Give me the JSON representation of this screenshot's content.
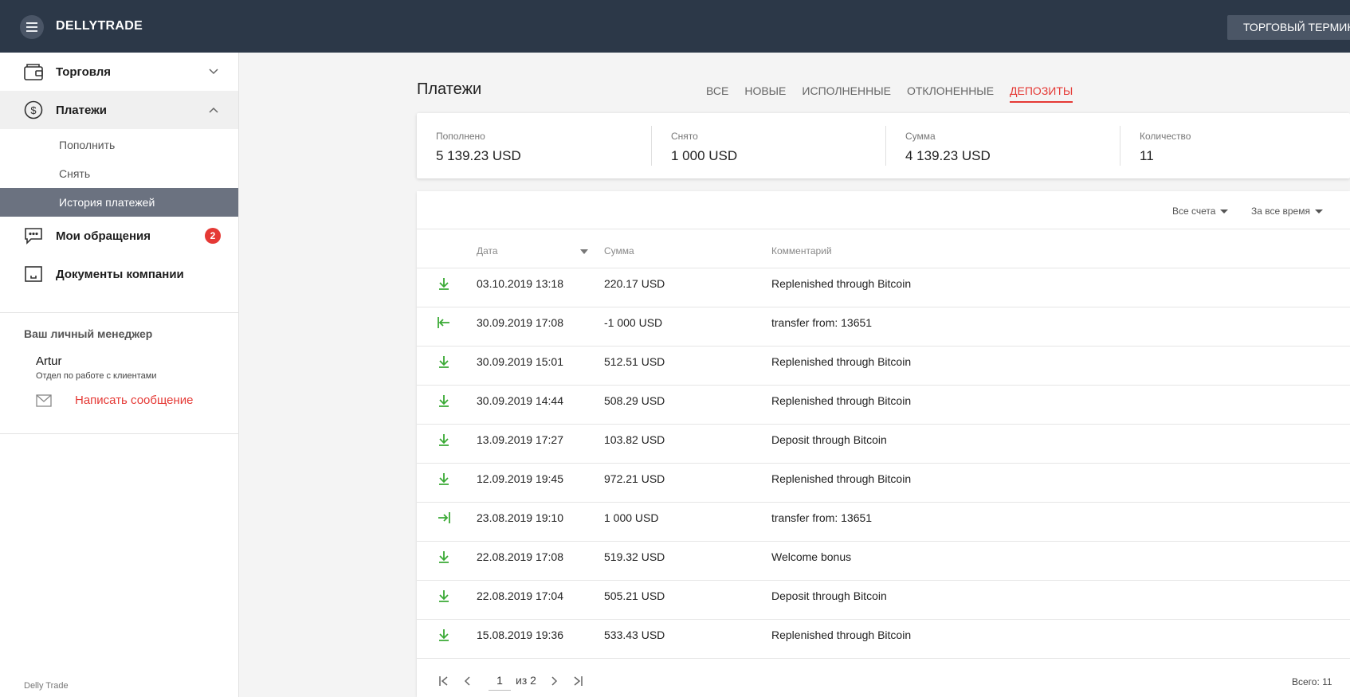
{
  "header": {
    "logo": "DELLYTRADE",
    "terminal_button": "ТОРГОВЫЙ ТЕРМИН"
  },
  "sidebar": {
    "trading": "Торговля",
    "payments": "Платежи",
    "sub": {
      "deposit": "Пополнить",
      "withdraw": "Снять",
      "history": "История платежей"
    },
    "requests": "Мои обращения",
    "requests_badge": "2",
    "documents": "Документы компании",
    "manager": {
      "title": "Ваш личный менеджер",
      "name": "Artur",
      "dept": "Отдел по работе с клиентами",
      "write": "Написать сообщение"
    },
    "footer": "Delly Trade"
  },
  "main": {
    "title": "Платежи",
    "tabs": [
      "ВСЕ",
      "НОВЫЕ",
      "ИСПОЛНЕННЫЕ",
      "ОТКЛОНЕННЫЕ",
      "ДЕПОЗИТЫ"
    ],
    "active_tab": "ДЕПОЗИТЫ",
    "summary": [
      {
        "label": "Пополнено",
        "value": "5 139.23 USD"
      },
      {
        "label": "Снято",
        "value": "1 000 USD"
      },
      {
        "label": "Сумма",
        "value": "4 139.23 USD"
      },
      {
        "label": "Количество",
        "value": "11"
      }
    ],
    "filters": {
      "accounts": "Все счета",
      "period": "За все время"
    },
    "columns": {
      "date": "Дата",
      "amount": "Сумма",
      "comment": "Комментарий"
    },
    "rows": [
      {
        "icon": "download-icon",
        "date": "03.10.2019 13:18",
        "amount": "220.17 USD",
        "comment": "Replenished through Bitcoin"
      },
      {
        "icon": "transfer-out-icon",
        "date": "30.09.2019 17:08",
        "amount": "-1 000 USD",
        "comment": "transfer from: 13651"
      },
      {
        "icon": "download-icon",
        "date": "30.09.2019 15:01",
        "amount": "512.51 USD",
        "comment": "Replenished through Bitcoin"
      },
      {
        "icon": "download-icon",
        "date": "30.09.2019 14:44",
        "amount": "508.29 USD",
        "comment": "Replenished through Bitcoin"
      },
      {
        "icon": "download-icon",
        "date": "13.09.2019 17:27",
        "amount": "103.82 USD",
        "comment": "Deposit through Bitcoin"
      },
      {
        "icon": "download-icon",
        "date": "12.09.2019 19:45",
        "amount": "972.21 USD",
        "comment": "Replenished through Bitcoin"
      },
      {
        "icon": "transfer-in-icon",
        "date": "23.08.2019 19:10",
        "amount": "1 000 USD",
        "comment": "transfer from: 13651"
      },
      {
        "icon": "download-icon",
        "date": "22.08.2019 17:08",
        "amount": "519.32 USD",
        "comment": "Welcome bonus"
      },
      {
        "icon": "download-icon",
        "date": "22.08.2019 17:04",
        "amount": "505.21 USD",
        "comment": "Deposit through Bitcoin"
      },
      {
        "icon": "download-icon",
        "date": "15.08.2019 19:36",
        "amount": "533.43 USD",
        "comment": "Replenished through Bitcoin"
      }
    ],
    "pager": {
      "page": "1",
      "of": "из 2",
      "total": "Всего: 11"
    }
  },
  "colors": {
    "header_bg": "#2c3848",
    "accent_red": "#e53935",
    "icon_green": "#3aaa35",
    "selected_sub": "#6b7280"
  }
}
